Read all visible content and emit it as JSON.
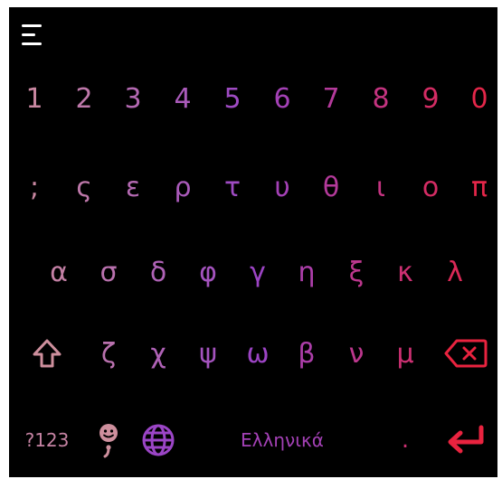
{
  "keyboard": {
    "rows": [
      [
        "1",
        "2",
        "3",
        "4",
        "5",
        "6",
        "7",
        "8",
        "9",
        "0"
      ],
      [
        ";",
        "ς",
        "ε",
        "ρ",
        "τ",
        "υ",
        "θ",
        "ι",
        "ο",
        "π"
      ],
      [
        "α",
        "σ",
        "δ",
        "φ",
        "γ",
        "η",
        "ξ",
        "κ",
        "λ"
      ],
      [
        "ζ",
        "χ",
        "ψ",
        "ω",
        "β",
        "ν",
        "μ"
      ]
    ],
    "bottom": {
      "symbols_label": "?123",
      "space_label": "Ελληνικά",
      "period_label": "."
    }
  },
  "colors": {
    "background": "#000000",
    "gradient_start": "#ce8f9d",
    "gradient_mid": "#9b45c6",
    "gradient_end": "#e9233f",
    "menu": "#ffffff"
  },
  "icons": [
    "menu-icon",
    "shift-icon",
    "backspace-icon",
    "emoji-icon",
    "globe-icon",
    "enter-icon"
  ]
}
